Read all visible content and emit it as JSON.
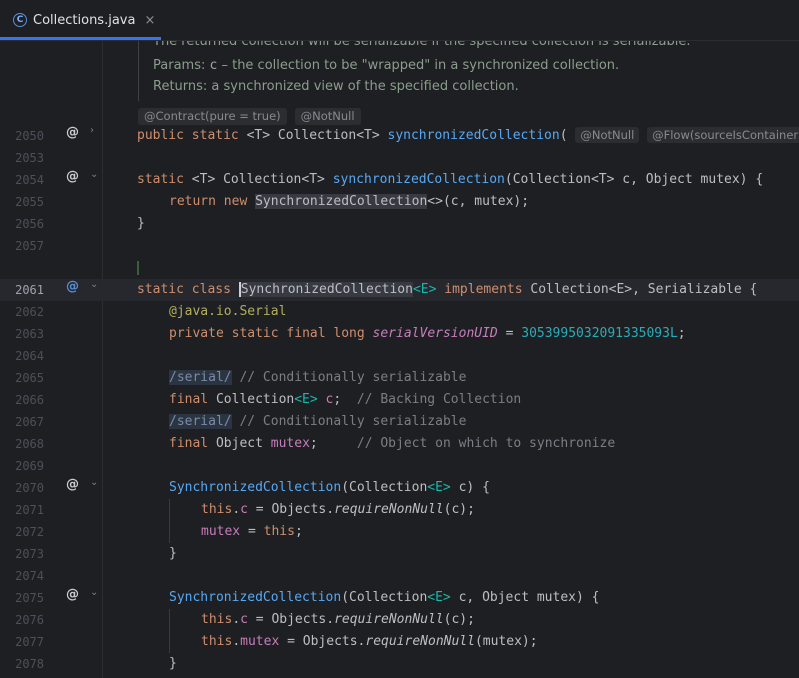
{
  "tab": {
    "icon": "class-c-icon",
    "icon_glyph": "C",
    "file_name": "Collections.java",
    "close_glyph": "×"
  },
  "doc": {
    "line1": "The returned collection will be serializable if the specified collection is serializable.",
    "params_label": "Params:",
    "params_name": "c",
    "params_text": " – the collection to be \"wrapped\" in a synchronized collection.",
    "returns_label": "Returns:",
    "returns_text": " a synchronized view of the specified collection."
  },
  "inlays": {
    "contract": "@Contract(pure = true)",
    "notnull": "@NotNull"
  },
  "gutter": {
    "at_glyph": "@",
    "chevron_right": "›",
    "chevron_down": "⌄"
  },
  "lines": {
    "l2050": "2050",
    "l2053": "2053",
    "l2054": "2054",
    "l2055": "2055",
    "l2056": "2056",
    "l2057": "2057",
    "l2061": "2061",
    "l2062": "2062",
    "l2063": "2063",
    "l2064": "2064",
    "l2065": "2065",
    "l2066": "2066",
    "l2067": "2067",
    "l2068": "2068",
    "l2069": "2069",
    "l2070": "2070",
    "l2071": "2071",
    "l2072": "2072",
    "l2073": "2073",
    "l2074": "2074",
    "l2075": "2075",
    "l2076": "2076",
    "l2077": "2077",
    "l2078": "2078"
  },
  "code": {
    "c2050": {
      "public": "public",
      "static": "static",
      "tparam": "<T>",
      "type": "Collection",
      "tparam2": "<T>",
      "method": "synchronizedCollection",
      "paren": "(",
      "inlay1": "@NotNull",
      "inlay2": "@Flow(sourceIsContainer"
    },
    "c2054": {
      "static": "static",
      "rest1": "<T> Collection<T> ",
      "method": "synchronizedCollection",
      "rest2": "(Collection<T> c, Object mutex) {"
    },
    "c2055": {
      "return": "return",
      "new": "new",
      "cls": "SynchronizedCollection",
      "rest": "<>(c, mutex);"
    },
    "c2056": "}",
    "c2061": {
      "static": "static",
      "class": "class",
      "cls_first": "S",
      "cls_rest": "ynchronizedCollection",
      "tparam": "<E>",
      "implements": "implements",
      "rest": " Collection<E>, Serializable {"
    },
    "c2062": {
      "at": "@",
      "pkg": "java.io.",
      "ann": "Serial"
    },
    "c2063": {
      "private": "private",
      "static": "static",
      "final": "final",
      "long": "long",
      "field": "serialVersionUID",
      "eq": " = ",
      "num": "3053995032091335093L",
      "semi": ";"
    },
    "c2065": {
      "serial": "/serial/",
      "cmt": " // Conditionally serializable"
    },
    "c2066": {
      "final": "final",
      "type": " Collection",
      "tparam": "<E>",
      "field": " c",
      "semi": ";",
      "cmt": "  // Backing Collection"
    },
    "c2067": {
      "serial": "/serial/",
      "cmt": " // Conditionally serializable"
    },
    "c2068": {
      "final": "final",
      "type": " Object ",
      "field": "mutex",
      "semi": ";",
      "cmt": "     // Object on which to synchronize"
    },
    "c2070": {
      "ctor": "SynchronizedCollection",
      "rest1": "(Collection",
      "tparam": "<E>",
      "rest2": " c) {"
    },
    "c2071": {
      "this": "this",
      "dot": ".",
      "field": "c",
      "eq": " = Objects.",
      "method": "requireNonNull",
      "rest": "(c);"
    },
    "c2072": {
      "field": "mutex",
      "eq": " = ",
      "this": "this",
      "semi": ";"
    },
    "c2073": "}",
    "c2075": {
      "ctor": "SynchronizedCollection",
      "rest1": "(Collection",
      "tparam": "<E>",
      "rest2": " c, Object mutex) {"
    },
    "c2076": {
      "this": "this",
      "dot": ".",
      "field": "c",
      "eq": " = Objects.",
      "method": "requireNonNull",
      "rest": "(c);"
    },
    "c2077": {
      "this": "this",
      "dot": ".",
      "field": "mutex",
      "eq": " = Objects.",
      "method": "requireNonNull",
      "rest": "(mutex);"
    },
    "c2078": "}"
  },
  "colors": {
    "keyword": "#cf8e6d",
    "method": "#56a8f5",
    "type_param": "#16baac",
    "field": "#c77dbb",
    "number": "#2aacb8",
    "annotation": "#b3ae60",
    "comment": "#7a7e85",
    "accent": "#3574f0"
  }
}
